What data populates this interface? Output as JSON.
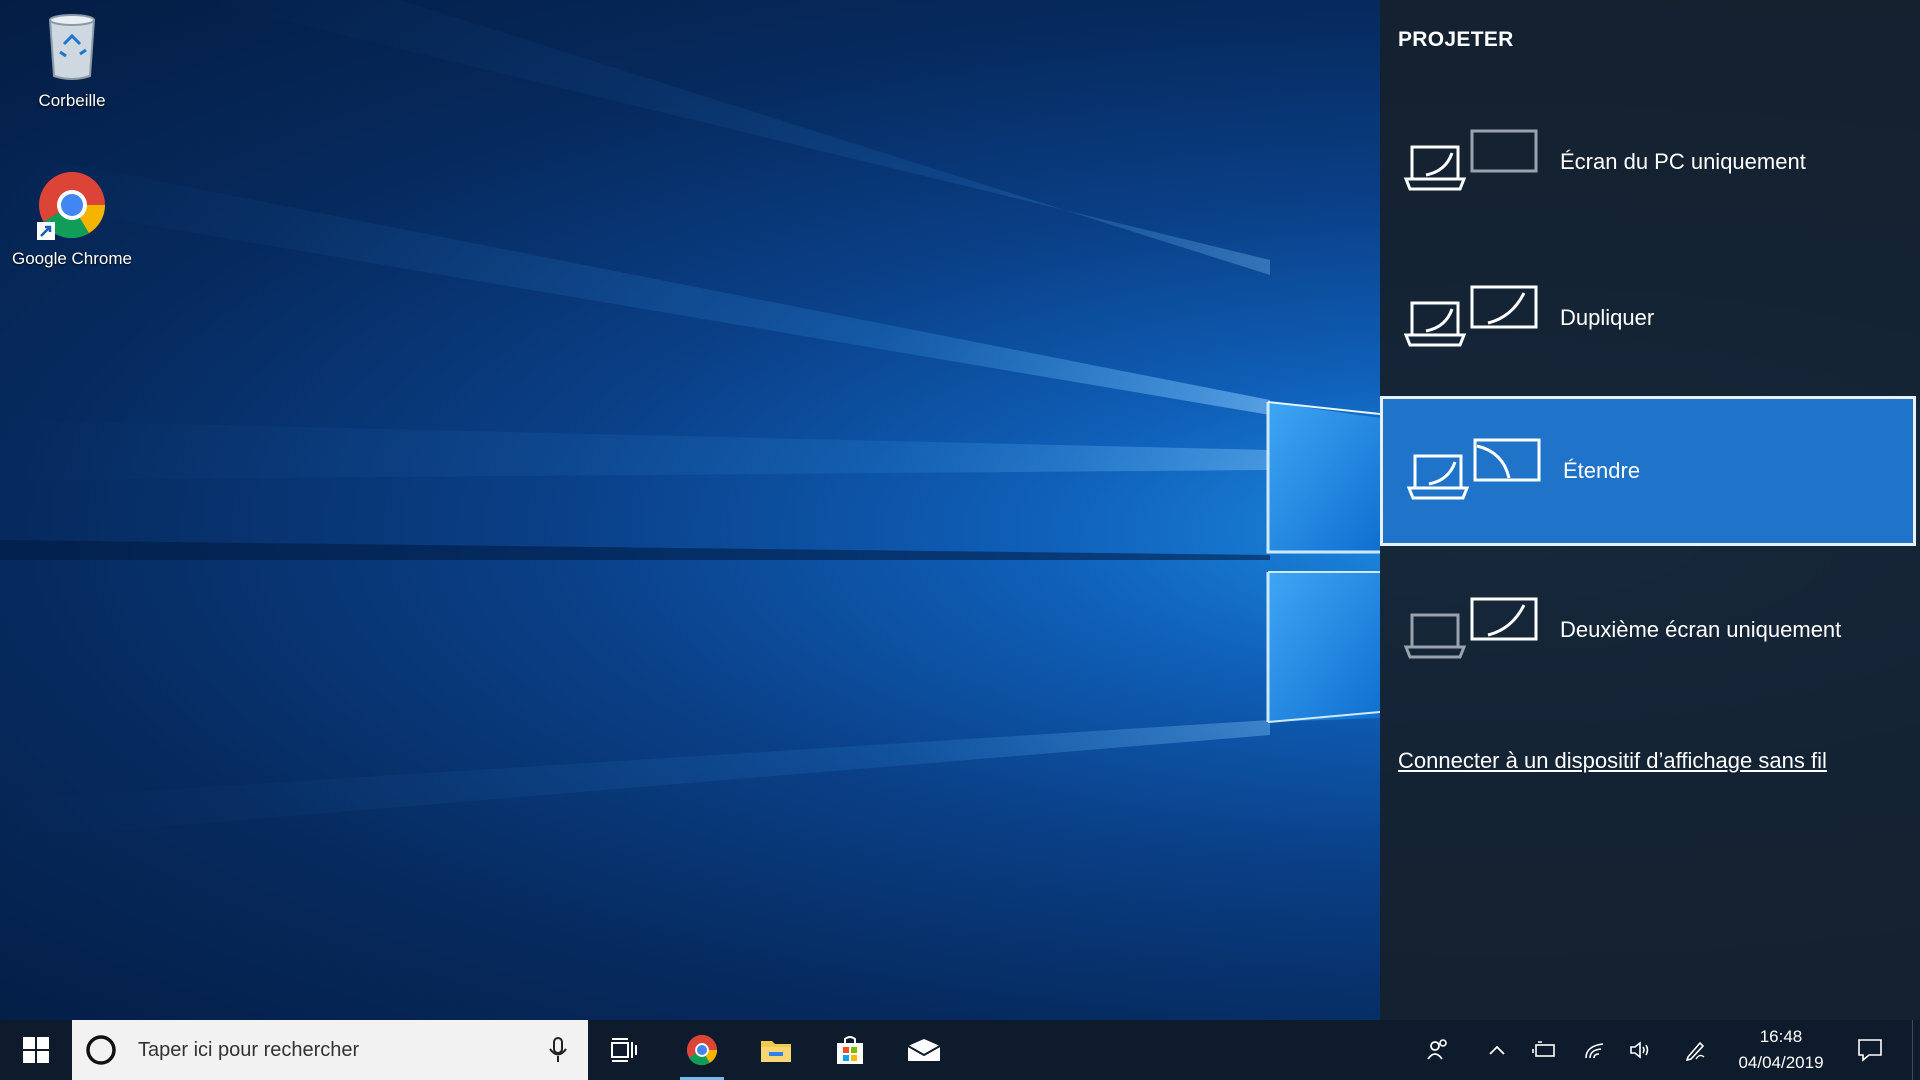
{
  "desktop": {
    "icons": [
      {
        "label": "Corbeille",
        "icon": "recycle-bin-icon"
      },
      {
        "label": "Google Chrome",
        "icon": "chrome-icon"
      }
    ]
  },
  "project_panel": {
    "title": "PROJETER",
    "options": [
      {
        "label": "Écran du PC uniquement",
        "icon": "pc-screen-only-icon",
        "selected": false
      },
      {
        "label": "Dupliquer",
        "icon": "duplicate-icon",
        "selected": false
      },
      {
        "label": "Étendre",
        "icon": "extend-icon",
        "selected": true
      },
      {
        "label": "Deuxième écran uniquement",
        "icon": "second-screen-only-icon",
        "selected": false
      }
    ],
    "wireless_link": "Connecter à un dispositif d’affichage sans fil",
    "selected_color": "#1f73c8"
  },
  "taskbar": {
    "search_placeholder": "Taper ici pour rechercher",
    "pinned": [
      {
        "icon": "task-view-icon"
      },
      {
        "icon": "chrome-icon",
        "active": true
      },
      {
        "icon": "file-explorer-icon"
      },
      {
        "icon": "microsoft-store-icon"
      },
      {
        "icon": "mail-icon"
      }
    ],
    "tray_icons": [
      "people-icon",
      "chevron-up-icon",
      "battery-icon",
      "wifi-icon",
      "volume-icon",
      "pen-icon",
      "notifications-icon"
    ],
    "clock": {
      "time": "16:48",
      "date": "04/04/2019"
    }
  }
}
